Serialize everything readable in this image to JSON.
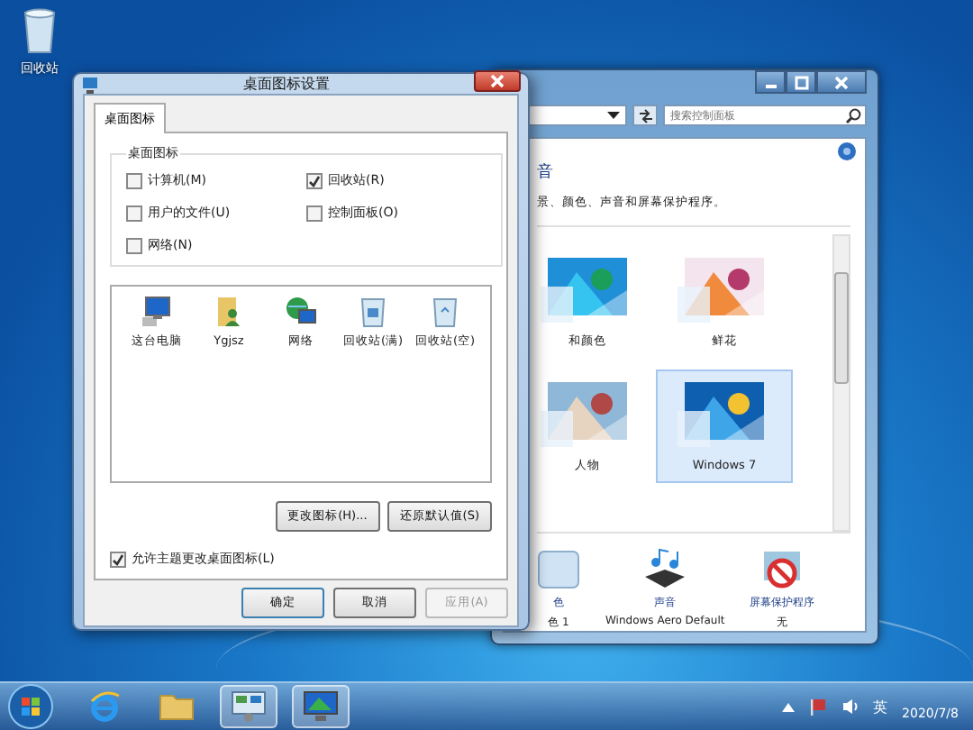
{
  "desktop_icons": [
    {
      "label": "回收站"
    }
  ],
  "background_window": {
    "search": {
      "placeholder": "搜索控制面板"
    },
    "heading": "音",
    "description": "景、颜色、声音和屏幕保护程序。",
    "themes": [
      {
        "label": "和颜色",
        "selected": false
      },
      {
        "label": "鲜花",
        "selected": false
      },
      {
        "label": "人物",
        "selected": false
      },
      {
        "label": "Windows 7",
        "selected": true
      }
    ],
    "settings": [
      {
        "kind": "color",
        "label": "色",
        "value": "色 1"
      },
      {
        "kind": "sound",
        "label": "声音",
        "value": "Windows Aero Default"
      },
      {
        "kind": "screensaver",
        "label": "屏幕保护程序",
        "value": "无"
      }
    ]
  },
  "dialog": {
    "title": "桌面图标设置",
    "tabs": [
      {
        "label": "桌面图标",
        "selected": true
      }
    ],
    "group_title": "桌面图标",
    "checkboxes": [
      {
        "label": "计算机(M)",
        "checked": false
      },
      {
        "label": "回收站(R)",
        "checked": true
      },
      {
        "label": "用户的文件(U)",
        "checked": false
      },
      {
        "label": "控制面板(O)",
        "checked": false
      },
      {
        "label": "网络(N)",
        "checked": false
      }
    ],
    "icons": [
      {
        "kind": "computer",
        "label": "这台电脑",
        "selected": false
      },
      {
        "kind": "user",
        "label": "Ygjsz",
        "selected": false
      },
      {
        "kind": "network",
        "label": "网络",
        "selected": false
      },
      {
        "kind": "bin-full",
        "label": "回收站(满)",
        "selected": false
      },
      {
        "kind": "bin-empty",
        "label": "回收站(空)",
        "selected": false
      }
    ],
    "change_icon_button": "更改图标(H)...",
    "restore_button": "还原默认值(S)",
    "allow_themes": {
      "label": "允许主题更改桌面图标(L)",
      "checked": true
    },
    "buttons": [
      {
        "label": "确定",
        "disabled": false
      },
      {
        "label": "取消",
        "disabled": false
      },
      {
        "label": "应用(A)",
        "disabled": true
      }
    ]
  },
  "taskbar": {
    "items": [
      {
        "kind": "start",
        "selected": false
      },
      {
        "kind": "ie",
        "selected": false
      },
      {
        "kind": "folder",
        "selected": false
      },
      {
        "kind": "control-panel",
        "selected": true
      },
      {
        "kind": "display",
        "selected": true
      }
    ],
    "tray": {
      "language": "英",
      "date": "2020/7/8"
    }
  }
}
